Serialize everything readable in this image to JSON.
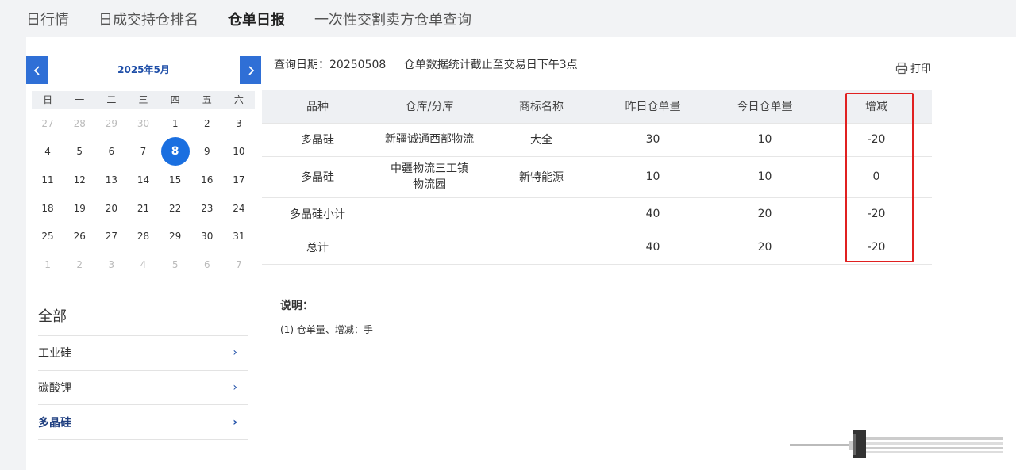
{
  "nav": {
    "tabs": [
      {
        "label": "日行情"
      },
      {
        "label": "日成交持仓排名"
      },
      {
        "label": "仓单日报"
      },
      {
        "label": "一次性交割卖方仓单查询"
      }
    ],
    "active_index": 2
  },
  "calendar": {
    "title": "2025年5月",
    "weekdays": [
      "日",
      "一",
      "二",
      "三",
      "四",
      "五",
      "六"
    ],
    "weeks": [
      [
        "27",
        "28",
        "29",
        "30",
        "1",
        "2",
        "3"
      ],
      [
        "4",
        "5",
        "6",
        "7",
        "8",
        "9",
        "10"
      ],
      [
        "11",
        "12",
        "13",
        "14",
        "15",
        "16",
        "17"
      ],
      [
        "18",
        "19",
        "20",
        "21",
        "22",
        "23",
        "24"
      ],
      [
        "25",
        "26",
        "27",
        "28",
        "29",
        "30",
        "31"
      ],
      [
        "1",
        "2",
        "3",
        "4",
        "5",
        "6",
        "7"
      ]
    ],
    "selected": "8"
  },
  "categories": {
    "title": "全部",
    "items": [
      {
        "label": "工业硅"
      },
      {
        "label": "碳酸锂"
      },
      {
        "label": "多晶硅"
      }
    ],
    "active_index": 2
  },
  "query": {
    "date_text": "查询日期：20250508",
    "cutoff_text": "仓单数据统计截止至交易日下午3点",
    "print_label": "打印"
  },
  "table": {
    "headers": [
      "品种",
      "仓库/分库",
      "商标名称",
      "昨日仓单量",
      "今日仓单量",
      "增减"
    ],
    "rows": [
      [
        "多晶硅",
        "新疆诚通西部物流",
        "大全",
        "30",
        "10",
        "-20"
      ],
      [
        "多晶硅",
        "中疆物流三工镇物流园",
        "新特能源",
        "10",
        "10",
        "0"
      ],
      [
        "多晶硅小计",
        "",
        "",
        "40",
        "20",
        "-20"
      ],
      [
        "总计",
        "",
        "",
        "40",
        "20",
        "-20"
      ]
    ]
  },
  "notes": {
    "title": "说明：",
    "text": "(1) 仓单量、增减：手"
  },
  "colors": {
    "accent": "#2f6fd6",
    "selected_day": "#1a6fe0",
    "highlight_box": "#e02020",
    "header_bg": "#eef0f3"
  }
}
